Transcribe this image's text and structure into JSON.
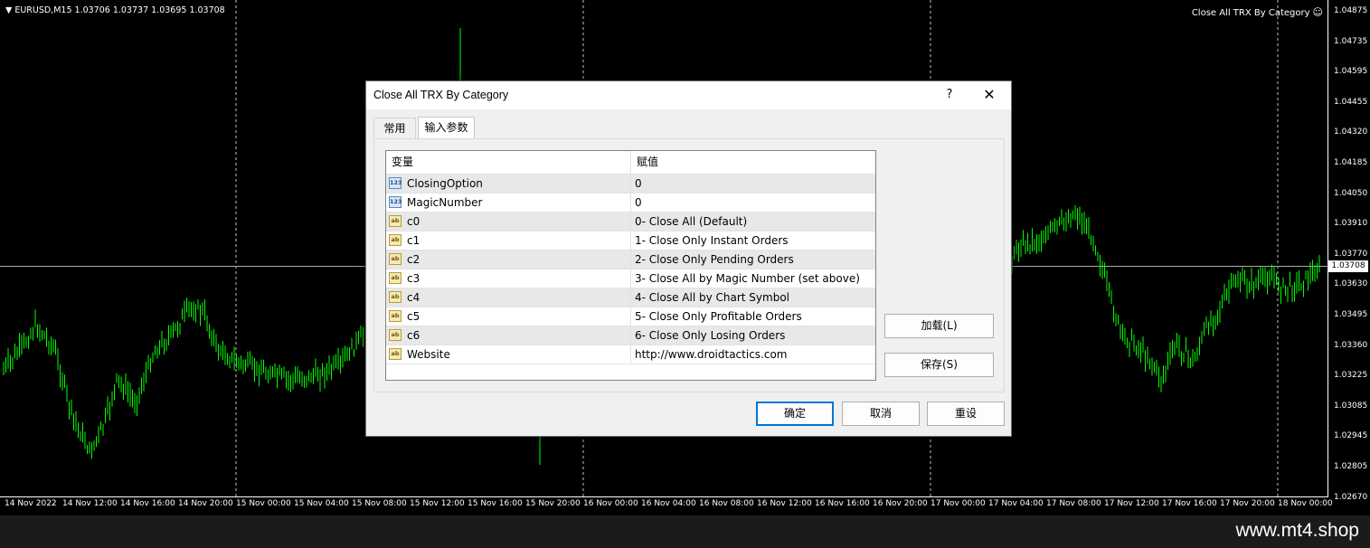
{
  "chart": {
    "symbol_info": "EURUSD,M15  1.03706 1.03737 1.03695 1.03708",
    "expert_label": "Close All TRX By Category",
    "expert_status_icon": "smiley-face-icon",
    "current_price": "1.03708",
    "price_labels": [
      "1.04875",
      "1.04735",
      "1.04595",
      "1.04455",
      "1.04320",
      "1.04185",
      "1.04050",
      "1.03910",
      "1.03770",
      "1.03630",
      "1.03495",
      "1.03360",
      "1.03225",
      "1.03085",
      "1.02945",
      "1.02805",
      "1.02670"
    ],
    "time_labels": [
      "14 Nov 2022",
      "14 Nov 12:00",
      "14 Nov 16:00",
      "14 Nov 20:00",
      "15 Nov 00:00",
      "15 Nov 04:00",
      "15 Nov 08:00",
      "15 Nov 12:00",
      "15 Nov 16:00",
      "15 Nov 20:00",
      "16 Nov 00:00",
      "16 Nov 04:00",
      "16 Nov 08:00",
      "16 Nov 12:00",
      "16 Nov 16:00",
      "16 Nov 20:00",
      "17 Nov 00:00",
      "17 Nov 04:00",
      "17 Nov 08:00",
      "17 Nov 12:00",
      "17 Nov 16:00",
      "17 Nov 20:00",
      "18 Nov 00:00"
    ],
    "colors": {
      "background": "#000000",
      "candles": "#00ff00",
      "grid": "#c0c0c0",
      "text": "#ffffff"
    }
  },
  "dialog": {
    "title": "Close All TRX By Category",
    "help_label": "?",
    "close_label": "✕",
    "tabs": [
      {
        "label": "常用"
      },
      {
        "label": "输入参数"
      }
    ],
    "active_tab": "输入参数",
    "columns": [
      "变量",
      "赋值"
    ],
    "rows": [
      {
        "type": "num",
        "type_icon": "123",
        "name": "ClosingOption",
        "value": "0"
      },
      {
        "type": "num",
        "type_icon": "123",
        "name": "MagicNumber",
        "value": "0"
      },
      {
        "type": "str",
        "type_icon": "ab",
        "name": "c0",
        "value": "0- Close All (Default)"
      },
      {
        "type": "str",
        "type_icon": "ab",
        "name": "c1",
        "value": "1- Close Only Instant Orders"
      },
      {
        "type": "str",
        "type_icon": "ab",
        "name": "c2",
        "value": "2- Close Only Pending Orders"
      },
      {
        "type": "str",
        "type_icon": "ab",
        "name": "c3",
        "value": "3- Close All by Magic Number (set above)"
      },
      {
        "type": "str",
        "type_icon": "ab",
        "name": "c4",
        "value": "4- Close All by Chart Symbol"
      },
      {
        "type": "str",
        "type_icon": "ab",
        "name": "c5",
        "value": "5- Close Only Profitable Orders"
      },
      {
        "type": "str",
        "type_icon": "ab",
        "name": "c6",
        "value": "6- Close Only Losing Orders"
      },
      {
        "type": "str",
        "type_icon": "ab",
        "name": "Website",
        "value": "http://www.droidtactics.com"
      }
    ],
    "side_buttons": {
      "load": "加载(L)",
      "save": "保存(S)"
    },
    "footer_buttons": {
      "ok": "确定",
      "cancel": "取消",
      "reset": "重设"
    }
  },
  "watermark": "www.mt4.shop"
}
